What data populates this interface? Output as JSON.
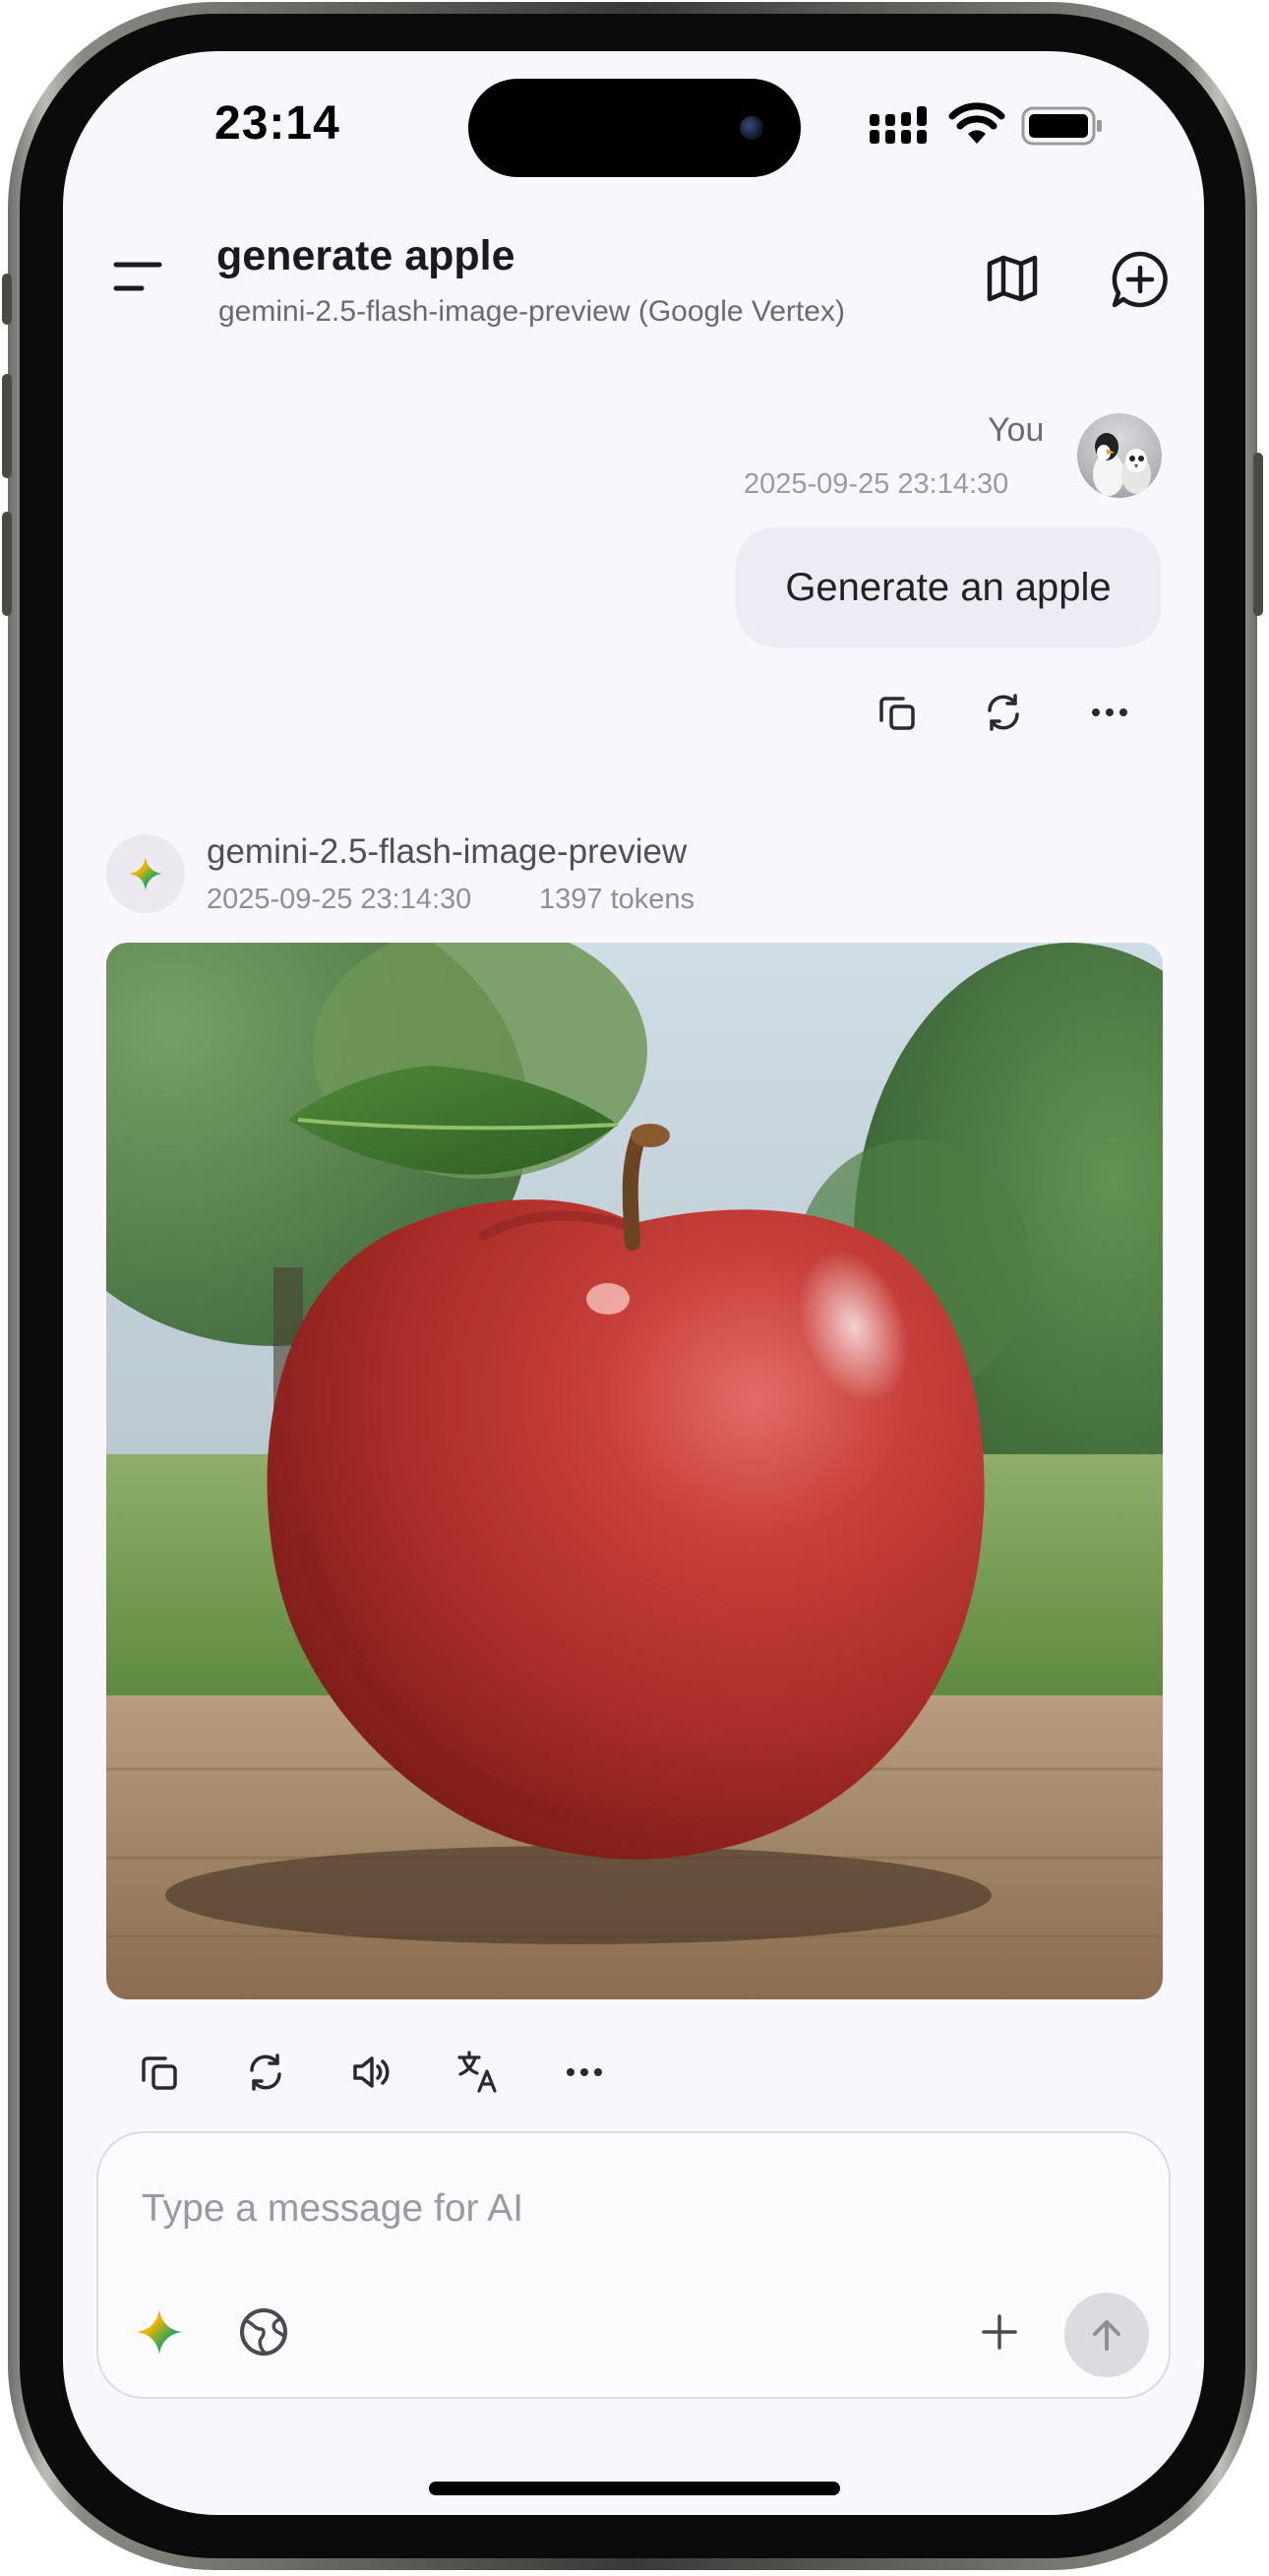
{
  "status_bar": {
    "time": "23:14"
  },
  "header": {
    "title": "generate apple",
    "subtitle": "gemini-2.5-flash-image-preview (Google Vertex)",
    "menu_icon": "menu-icon",
    "map_icon": "map-icon",
    "new_chat_icon": "new-chat-icon"
  },
  "user_message": {
    "author": "You",
    "timestamp": "2025-09-25 23:14:30",
    "text": "Generate an apple",
    "actions": [
      "copy-icon",
      "regenerate-icon",
      "more-icon"
    ]
  },
  "assistant_message": {
    "model": "gemini-2.5-flash-image-preview",
    "timestamp": "2025-09-25 23:14:30",
    "tokens": "1397 tokens",
    "image_alt": "Generated image of a red apple on a wooden table",
    "actions": [
      "copy-icon",
      "regenerate-icon",
      "speaker-icon",
      "translate-icon",
      "more-icon"
    ]
  },
  "composer": {
    "placeholder": "Type a message for AI",
    "value": "",
    "left_icons": [
      "gemini-sparkle-icon",
      "web-search-icon"
    ],
    "right_icons": [
      "add-icon",
      "send-icon"
    ]
  },
  "colors": {
    "screen_bg": "#f9f7fb",
    "user_bubble": "#ececf4",
    "text_primary": "#1b1b1f",
    "text_muted": "#9b9aa0",
    "send_button": "#dcdce0"
  }
}
